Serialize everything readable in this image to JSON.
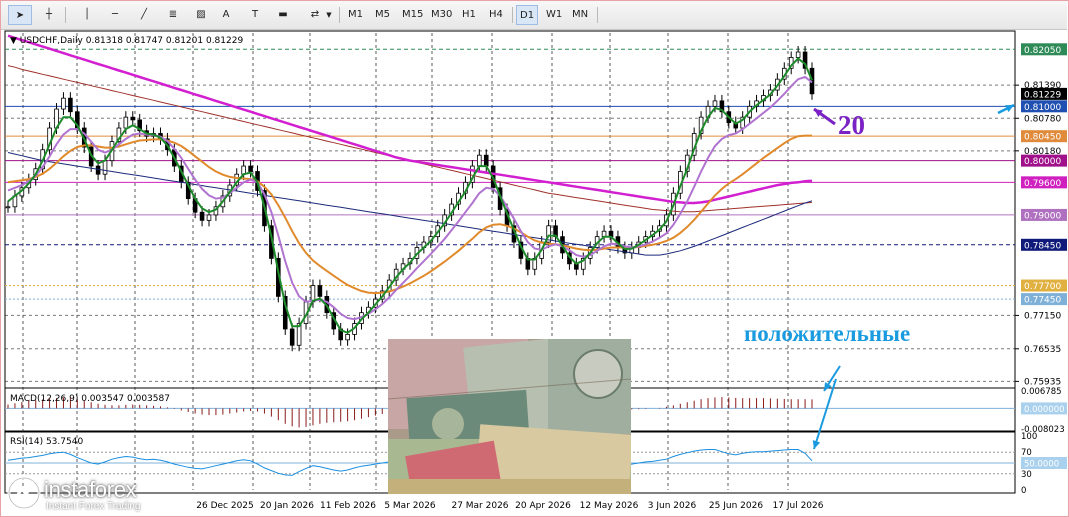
{
  "toolbar": {
    "tools": [
      {
        "name": "cursor-icon",
        "glyph": "➤"
      },
      {
        "name": "crosshair-icon",
        "glyph": "┼"
      },
      {
        "name": "vertical-line-icon",
        "glyph": "│"
      },
      {
        "name": "horizontal-line-icon",
        "glyph": "─"
      },
      {
        "name": "trendline-icon",
        "glyph": "╱"
      },
      {
        "name": "fibonacci-icon",
        "glyph": "≣"
      },
      {
        "name": "channel-icon",
        "glyph": "▨"
      },
      {
        "name": "text-icon",
        "glyph": "A"
      },
      {
        "name": "text-label-icon",
        "glyph": "T"
      },
      {
        "name": "rectangle-icon",
        "glyph": "▬"
      },
      {
        "name": "arrows-icon",
        "glyph": "⇄"
      }
    ],
    "timeframes": [
      "M1",
      "M5",
      "M15",
      "M30",
      "H1",
      "H4",
      "D1",
      "W1",
      "MN"
    ],
    "active_timeframe": "D1"
  },
  "chart_data": [
    {
      "type": "line",
      "title": "USDCHF,Daily",
      "ohlc_label": "0.81318 0.81747 0.81201 0.81229",
      "x_tick_labels": [
        "26 Dec 2025",
        "20 Jan 2026",
        "11 Feb 2026",
        "5 Mar 2026",
        "27 Mar 2026",
        "20 Apr 2026",
        "12 May 2026",
        "3 Jun 2026",
        "25 Jun 2026",
        "17 Jul 2026"
      ],
      "y_tick_labels": [
        "0.81390",
        "0.80780",
        "0.80180",
        "0.77150",
        "0.76535",
        "0.75935"
      ],
      "ylim": [
        0.7585,
        0.8235
      ],
      "price_levels": [
        {
          "label": "0.82050",
          "value": 0.8205,
          "color": "#2e8b57"
        },
        {
          "label": "0.81229",
          "value": 0.81229,
          "color": "#000000"
        },
        {
          "label": "0.81000",
          "value": 0.81,
          "color": "#1f4fb0"
        },
        {
          "label": "0.80450",
          "value": 0.8045,
          "color": "#e08a3c"
        },
        {
          "label": "0.80000",
          "value": 0.8,
          "color": "#a0108a"
        },
        {
          "label": "0.79600",
          "value": 0.796,
          "color": "#d020c0"
        },
        {
          "label": "0.79000",
          "value": 0.79,
          "color": "#b070c0"
        },
        {
          "label": "0.78450",
          "value": 0.7845,
          "color": "#101a7a"
        },
        {
          "label": "0.77700",
          "value": 0.777,
          "color": "#e0b040"
        },
        {
          "label": "0.77450",
          "value": 0.7745,
          "color": "#7fb0d8"
        }
      ],
      "close": [
        0.7915,
        0.7935,
        0.795,
        0.7965,
        0.7985,
        0.802,
        0.806,
        0.8095,
        0.8115,
        0.809,
        0.806,
        0.8025,
        0.799,
        0.7975,
        0.8,
        0.8035,
        0.806,
        0.808,
        0.8075,
        0.8055,
        0.8045,
        0.805,
        0.804,
        0.802,
        0.799,
        0.796,
        0.793,
        0.7905,
        0.789,
        0.79,
        0.7915,
        0.7935,
        0.7955,
        0.7975,
        0.799,
        0.798,
        0.7945,
        0.788,
        0.782,
        0.775,
        0.769,
        0.766,
        0.77,
        0.774,
        0.777,
        0.775,
        0.772,
        0.769,
        0.767,
        0.768,
        0.77,
        0.772,
        0.773,
        0.7745,
        0.776,
        0.778,
        0.78,
        0.781,
        0.782,
        0.784,
        0.785,
        0.786,
        0.788,
        0.79,
        0.792,
        0.794,
        0.796,
        0.799,
        0.801,
        0.799,
        0.795,
        0.791,
        0.788,
        0.785,
        0.782,
        0.78,
        0.782,
        0.785,
        0.788,
        0.786,
        0.783,
        0.781,
        0.78,
        0.782,
        0.784,
        0.786,
        0.787,
        0.786,
        0.784,
        0.783,
        0.784,
        0.785,
        0.786,
        0.787,
        0.788,
        0.79,
        0.794,
        0.798,
        0.801,
        0.805,
        0.808,
        0.81,
        0.811,
        0.809,
        0.807,
        0.806,
        0.808,
        0.81,
        0.811,
        0.812,
        0.813,
        0.815,
        0.817,
        0.819,
        0.82,
        0.817,
        0.8123
      ],
      "ma_green": [
        0.7925,
        0.7935,
        0.7945,
        0.7958,
        0.7975,
        0.8,
        0.803,
        0.806,
        0.808,
        0.808,
        0.8065,
        0.804,
        0.801,
        0.7995,
        0.8,
        0.802,
        0.804,
        0.8058,
        0.8065,
        0.8058,
        0.805,
        0.8048,
        0.8042,
        0.8028,
        0.8005,
        0.798,
        0.7955,
        0.793,
        0.7912,
        0.7905,
        0.791,
        0.7925,
        0.7942,
        0.796,
        0.7975,
        0.7978,
        0.796,
        0.7915,
        0.786,
        0.7795,
        0.7735,
        0.7695,
        0.7695,
        0.7715,
        0.7742,
        0.7746,
        0.7733,
        0.771,
        0.7688,
        0.7683,
        0.7692,
        0.7708,
        0.772,
        0.7735,
        0.775,
        0.7767,
        0.7785,
        0.78,
        0.7812,
        0.7828,
        0.784,
        0.7852,
        0.7868,
        0.7885,
        0.7904,
        0.7924,
        0.7943,
        0.7968,
        0.799,
        0.799,
        0.7968,
        0.7935,
        0.7903,
        0.7872,
        0.7842,
        0.7818,
        0.7818,
        0.7836,
        0.7862,
        0.7862,
        0.7843,
        0.7823,
        0.781,
        0.7816,
        0.783,
        0.7848,
        0.786,
        0.786,
        0.7848,
        0.7837,
        0.7838,
        0.7845,
        0.7854,
        0.7863,
        0.7873,
        0.7888,
        0.7918,
        0.7953,
        0.7985,
        0.8022,
        0.8055,
        0.808,
        0.8097,
        0.8093,
        0.808,
        0.8068,
        0.8075,
        0.809,
        0.8102,
        0.8112,
        0.8122,
        0.8138,
        0.8156,
        0.8175,
        0.8188,
        0.8178,
        0.8148
      ],
      "ma_violet": [
        0.7945,
        0.795,
        0.7955,
        0.7962,
        0.7972,
        0.7988,
        0.8008,
        0.803,
        0.8048,
        0.8058,
        0.8058,
        0.805,
        0.8035,
        0.802,
        0.8015,
        0.802,
        0.803,
        0.804,
        0.8048,
        0.805,
        0.8048,
        0.8047,
        0.8044,
        0.8036,
        0.8022,
        0.8005,
        0.7985,
        0.7965,
        0.7948,
        0.7936,
        0.793,
        0.7932,
        0.794,
        0.795,
        0.796,
        0.7965,
        0.796,
        0.7938,
        0.7905,
        0.7862,
        0.7815,
        0.7775,
        0.775,
        0.774,
        0.7742,
        0.7744,
        0.774,
        0.773,
        0.7718,
        0.771,
        0.7708,
        0.7712,
        0.7718,
        0.7726,
        0.7736,
        0.7748,
        0.7762,
        0.7775,
        0.7788,
        0.7802,
        0.7815,
        0.7828,
        0.7842,
        0.7856,
        0.7872,
        0.7888,
        0.7905,
        0.7922,
        0.794,
        0.795,
        0.7948,
        0.7935,
        0.7915,
        0.7893,
        0.787,
        0.785,
        0.7838,
        0.7836,
        0.7842,
        0.7846,
        0.7842,
        0.7835,
        0.7826,
        0.7823,
        0.7826,
        0.7834,
        0.7842,
        0.7847,
        0.7846,
        0.7842,
        0.784,
        0.7842,
        0.7846,
        0.7851,
        0.7858,
        0.7866,
        0.7882,
        0.7902,
        0.7925,
        0.7952,
        0.798,
        0.8005,
        0.8027,
        0.804,
        0.8047,
        0.805,
        0.8058,
        0.8068,
        0.8078,
        0.8088,
        0.8098,
        0.811,
        0.8123,
        0.8137,
        0.815,
        0.8154,
        0.8144
      ],
      "ma_orange": [
        0.796,
        0.7962,
        0.7964,
        0.7966,
        0.797,
        0.7976,
        0.7985,
        0.7996,
        0.8008,
        0.8018,
        0.8025,
        0.8028,
        0.8028,
        0.8026,
        0.8024,
        0.8024,
        0.8026,
        0.803,
        0.8034,
        0.8037,
        0.8038,
        0.8039,
        0.8039,
        0.8037,
        0.8033,
        0.8027,
        0.8018,
        0.8008,
        0.7998,
        0.7988,
        0.798,
        0.7974,
        0.797,
        0.7968,
        0.7967,
        0.7966,
        0.7962,
        0.7952,
        0.7938,
        0.7918,
        0.7895,
        0.787,
        0.7848,
        0.783,
        0.7816,
        0.7806,
        0.7797,
        0.7788,
        0.7779,
        0.7771,
        0.7765,
        0.776,
        0.7757,
        0.7756,
        0.7757,
        0.7759,
        0.7763,
        0.7768,
        0.7774,
        0.7781,
        0.7788,
        0.7796,
        0.7805,
        0.7814,
        0.7824,
        0.7834,
        0.7845,
        0.7856,
        0.7868,
        0.7877,
        0.7882,
        0.7883,
        0.788,
        0.7875,
        0.7868,
        0.786,
        0.7853,
        0.7849,
        0.7847,
        0.7846,
        0.7844,
        0.7841,
        0.7838,
        0.7836,
        0.7835,
        0.7836,
        0.7838,
        0.784,
        0.784,
        0.784,
        0.784,
        0.7841,
        0.7843,
        0.7845,
        0.7848,
        0.7852,
        0.7858,
        0.7867,
        0.7878,
        0.7891,
        0.7906,
        0.7921,
        0.7936,
        0.7948,
        0.7958,
        0.7966,
        0.7975,
        0.7985,
        0.7995,
        0.8005,
        0.8014,
        0.8023,
        0.8032,
        0.804,
        0.8045,
        0.8046,
        0.8046
      ],
      "ma_magenta": [
        0.823,
        0.8226,
        0.8222,
        0.8218,
        0.8214,
        0.821,
        0.8206,
        0.8202,
        0.8198,
        0.8194,
        0.819,
        0.8186,
        0.8182,
        0.8178,
        0.8174,
        0.817,
        0.8166,
        0.8162,
        0.8158,
        0.8154,
        0.815,
        0.8146,
        0.8142,
        0.8138,
        0.8134,
        0.813,
        0.8126,
        0.8122,
        0.8118,
        0.8114,
        0.811,
        0.8106,
        0.8102,
        0.8098,
        0.8094,
        0.809,
        0.8086,
        0.8082,
        0.8078,
        0.8074,
        0.807,
        0.8066,
        0.8062,
        0.8058,
        0.8054,
        0.805,
        0.8046,
        0.8042,
        0.8038,
        0.8034,
        0.803,
        0.8026,
        0.8022,
        0.8018,
        0.8014,
        0.801,
        0.8006,
        0.8003,
        0.8,
        0.7998,
        0.7996,
        0.7994,
        0.7992,
        0.799,
        0.7988,
        0.7986,
        0.7984,
        0.7982,
        0.798,
        0.7978,
        0.7976,
        0.7974,
        0.7972,
        0.797,
        0.7968,
        0.7966,
        0.7964,
        0.7962,
        0.796,
        0.7958,
        0.7956,
        0.7954,
        0.7952,
        0.795,
        0.7948,
        0.7946,
        0.7944,
        0.7942,
        0.794,
        0.7938,
        0.7936,
        0.7934,
        0.7932,
        0.793,
        0.7928,
        0.7926,
        0.7924,
        0.7923,
        0.7922,
        0.7922,
        0.7923,
        0.7925,
        0.7928,
        0.7931,
        0.7934,
        0.7937,
        0.794,
        0.7943,
        0.7946,
        0.7949,
        0.7952,
        0.7955,
        0.7957,
        0.7959,
        0.796,
        0.7962,
        0.7963
      ],
      "ma_darkred": [
        0.8175,
        0.8172,
        0.8168,
        0.8165,
        0.8162,
        0.8159,
        0.8156,
        0.8153,
        0.815,
        0.8147,
        0.8144,
        0.8141,
        0.8138,
        0.8135,
        0.8132,
        0.8129,
        0.8126,
        0.8123,
        0.812,
        0.8117,
        0.8114,
        0.8111,
        0.8108,
        0.8105,
        0.8102,
        0.8099,
        0.8096,
        0.8093,
        0.809,
        0.8087,
        0.8084,
        0.8081,
        0.8078,
        0.8075,
        0.8072,
        0.8069,
        0.8066,
        0.8063,
        0.806,
        0.8057,
        0.8054,
        0.8051,
        0.8048,
        0.8045,
        0.8042,
        0.8039,
        0.8036,
        0.8033,
        0.803,
        0.8027,
        0.8024,
        0.8021,
        0.8018,
        0.8015,
        0.8012,
        0.8009,
        0.8006,
        0.8003,
        0.8,
        0.7997,
        0.7994,
        0.7991,
        0.7988,
        0.7985,
        0.7982,
        0.7979,
        0.7976,
        0.7973,
        0.797,
        0.7967,
        0.7964,
        0.7961,
        0.7958,
        0.7955,
        0.7952,
        0.7949,
        0.7946,
        0.7943,
        0.794,
        0.7938,
        0.7936,
        0.7934,
        0.7932,
        0.793,
        0.7928,
        0.7926,
        0.7924,
        0.7922,
        0.792,
        0.7918,
        0.7916,
        0.7914,
        0.7912,
        0.791,
        0.7909,
        0.7908,
        0.7907,
        0.7906,
        0.7906,
        0.7906,
        0.7907,
        0.7908,
        0.7909,
        0.791,
        0.7911,
        0.7912,
        0.7913,
        0.7914,
        0.7915,
        0.7916,
        0.7917,
        0.7918,
        0.7919,
        0.792,
        0.7921,
        0.7922,
        0.7923
      ],
      "ma_navy": [
        0.8015,
        0.8012,
        0.8009,
        0.8006,
        0.8003,
        0.8,
        0.7998,
        0.7996,
        0.7994,
        0.7992,
        0.799,
        0.7988,
        0.7986,
        0.7984,
        0.7982,
        0.798,
        0.7978,
        0.7976,
        0.7974,
        0.7972,
        0.797,
        0.7968,
        0.7966,
        0.7964,
        0.7962,
        0.796,
        0.7958,
        0.7956,
        0.7954,
        0.7952,
        0.795,
        0.7948,
        0.7946,
        0.7944,
        0.7942,
        0.794,
        0.7938,
        0.7936,
        0.7934,
        0.7932,
        0.793,
        0.7928,
        0.7926,
        0.7924,
        0.7922,
        0.792,
        0.7918,
        0.7916,
        0.7914,
        0.7912,
        0.791,
        0.7908,
        0.7906,
        0.7904,
        0.7902,
        0.79,
        0.7898,
        0.7896,
        0.7894,
        0.7892,
        0.789,
        0.7888,
        0.7886,
        0.7884,
        0.7882,
        0.788,
        0.7878,
        0.7876,
        0.7874,
        0.7872,
        0.787,
        0.7868,
        0.7866,
        0.7864,
        0.7862,
        0.786,
        0.7858,
        0.7856,
        0.7854,
        0.7852,
        0.785,
        0.7848,
        0.7846,
        0.7844,
        0.7842,
        0.784,
        0.7838,
        0.7836,
        0.7834,
        0.7832,
        0.783,
        0.7828,
        0.7826,
        0.7826,
        0.7826,
        0.7828,
        0.7831,
        0.7834,
        0.7838,
        0.7842,
        0.7847,
        0.7852,
        0.7857,
        0.7862,
        0.7867,
        0.7872,
        0.7877,
        0.7882,
        0.7887,
        0.7892,
        0.7897,
        0.7902,
        0.7907,
        0.7912,
        0.7917,
        0.7922,
        0.7926
      ]
    },
    {
      "type": "bar",
      "title": "MACD(12,26,9) 0.003547 0.003587",
      "y_tick_labels": [
        "0.006785",
        "0.000000",
        "-0.008023"
      ],
      "ylim": [
        -0.008023,
        0.006785
      ],
      "values": [
        0.0015,
        0.002,
        0.0025,
        0.003,
        0.0032,
        0.0035,
        0.0038,
        0.004,
        0.0042,
        0.004,
        0.0036,
        0.003,
        0.0024,
        0.0018,
        0.0014,
        0.0012,
        0.0012,
        0.0014,
        0.0015,
        0.0014,
        0.0012,
        0.001,
        0.0008,
        0.0004,
        -0.0002,
        -0.0008,
        -0.0014,
        -0.002,
        -0.0024,
        -0.0026,
        -0.0026,
        -0.0024,
        -0.002,
        -0.0016,
        -0.0012,
        -0.001,
        -0.0012,
        -0.002,
        -0.0032,
        -0.0046,
        -0.006,
        -0.007,
        -0.0074,
        -0.0072,
        -0.0066,
        -0.006,
        -0.0056,
        -0.0054,
        -0.0052,
        -0.005,
        -0.0046,
        -0.004,
        -0.0034,
        -0.0028,
        -0.0022,
        -0.0016,
        -0.001,
        -0.0006,
        -0.0002,
        0.0002,
        0.0006,
        0.001,
        0.0014,
        0.0018,
        0.0022,
        0.0026,
        0.003,
        0.0034,
        0.0036,
        0.0034,
        0.0028,
        0.002,
        0.0012,
        0.0004,
        -0.0004,
        -0.001,
        -0.0012,
        -0.001,
        -0.0006,
        -0.0004,
        -0.0004,
        -0.0006,
        -0.0008,
        -0.0008,
        -0.0006,
        -0.0004,
        -0.0002,
        -0.0002,
        -0.0003,
        -0.0004,
        -0.0004,
        -0.0003,
        -0.0002,
        0.0,
        0.0002,
        0.0006,
        0.0012,
        0.0018,
        0.0024,
        0.003,
        0.0036,
        0.004,
        0.0043,
        0.0044,
        0.0043,
        0.0041,
        0.004,
        0.004,
        0.004,
        0.004,
        0.0039,
        0.0038,
        0.0037,
        0.0036,
        0.0036,
        0.0036,
        0.0035
      ]
    },
    {
      "type": "line",
      "title": "RSI(14) 53.7540",
      "y_tick_labels": [
        "100",
        "70",
        "50",
        "30",
        "0"
      ],
      "ylim": [
        0,
        100
      ],
      "levels": [
        {
          "label": "50.0000",
          "value": 50
        }
      ],
      "values": [
        55,
        57,
        59,
        60,
        62,
        64,
        67,
        69,
        70,
        66,
        60,
        55,
        50,
        48,
        52,
        57,
        60,
        62,
        61,
        58,
        56,
        57,
        55,
        52,
        48,
        45,
        42,
        40,
        39,
        42,
        45,
        48,
        51,
        54,
        56,
        54,
        48,
        41,
        36,
        31,
        28,
        27,
        34,
        40,
        45,
        43,
        40,
        37,
        35,
        37,
        41,
        44,
        46,
        48,
        50,
        52,
        54,
        55,
        56,
        58,
        59,
        60,
        62,
        63,
        65,
        66,
        67,
        69,
        70,
        65,
        58,
        52,
        48,
        45,
        41,
        39,
        43,
        48,
        52,
        49,
        45,
        43,
        42,
        45,
        48,
        51,
        52,
        50,
        47,
        46,
        48,
        50,
        52,
        53,
        55,
        57,
        62,
        66,
        69,
        72,
        74,
        75,
        75,
        71,
        67,
        65,
        68,
        70,
        71,
        71,
        72,
        73,
        74,
        75,
        75,
        68,
        54
      ]
    }
  ],
  "annotations": {
    "note_positive": "положительные",
    "note_20": "20"
  },
  "logo": {
    "name": "instaforex",
    "subtitle": "Instant Forex Trading"
  }
}
